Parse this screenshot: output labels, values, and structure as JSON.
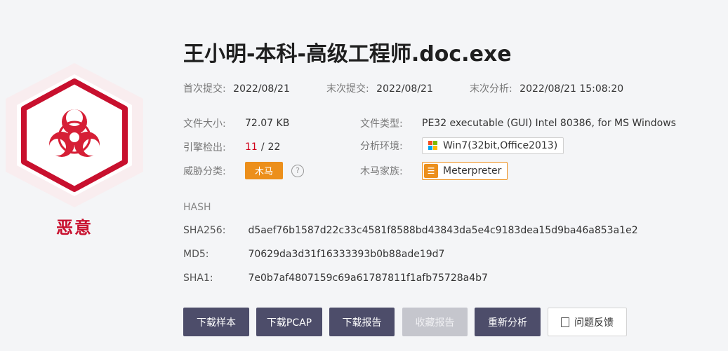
{
  "file_name": "王小明-本科-高级工程师.doc.exe",
  "verdict": "恶意",
  "verdict_color": "#c8102e",
  "meta": {
    "first_submit_label": "首次提交:",
    "first_submit_value": "2022/08/21",
    "last_submit_label": "末次提交:",
    "last_submit_value": "2022/08/21",
    "last_analysis_label": "末次分析:",
    "last_analysis_value": "2022/08/21 15:08:20"
  },
  "details": {
    "file_size_label": "文件大小:",
    "file_size_value": "72.07 KB",
    "file_type_label": "文件类型:",
    "file_type_value": "PE32 executable (GUI) Intel 80386, for MS Windows",
    "engine_label": "引擎检出:",
    "engine_detected": "11",
    "engine_sep": "/",
    "engine_total": "22",
    "env_label": "分析环境:",
    "env_value": "Win7(32bit,Office2013)",
    "threat_label": "威胁分类:",
    "threat_value": "木马",
    "family_label": "木马家族:",
    "family_value": "Meterpreter"
  },
  "hash": {
    "heading": "HASH",
    "sha256_label": "SHA256:",
    "sha256_value": "d5aef76b1587d22c33c4581f8588bd43843da5e4c9183dea15d9ba46a853a1e2",
    "md5_label": "MD5:",
    "md5_value": "70629da3d31f16333393b0b88ade19d7",
    "sha1_label": "SHA1:",
    "sha1_value": "7e0b7af4807159c69a61787811f1afb75728a4b7"
  },
  "actions": {
    "download_sample": "下载样本",
    "download_pcap": "下载PCAP",
    "download_report": "下载报告",
    "favorite_report": "收藏报告",
    "reanalyze": "重新分析",
    "feedback": "问题反馈"
  },
  "colors": {
    "button_dark": "#4d4d6a",
    "button_disabled": "#c5c6cd",
    "trojan_tag": "#ec8f1b",
    "detection_red": "#d0021b"
  }
}
